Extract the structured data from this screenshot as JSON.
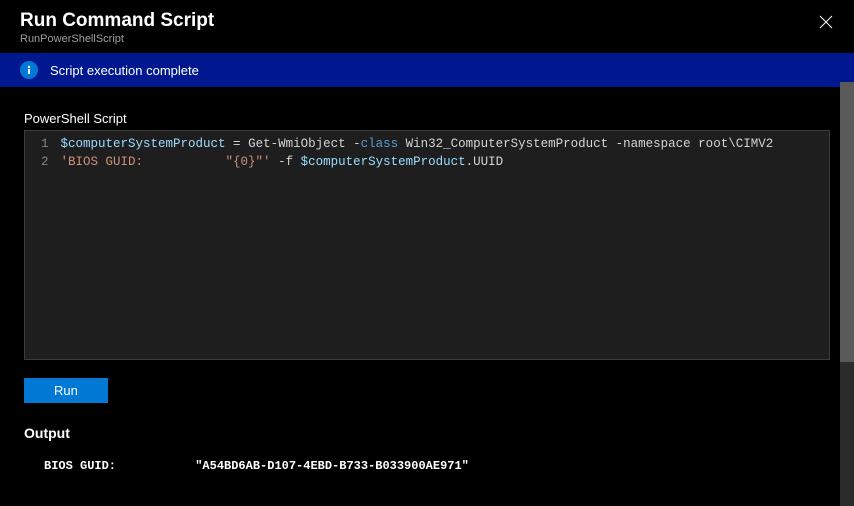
{
  "header": {
    "title": "Run Command Script",
    "subtitle": "RunPowerShellScript"
  },
  "status": {
    "message": "Script execution complete"
  },
  "editor": {
    "label": "PowerShell Script",
    "lines": {
      "num1": "1",
      "num2": "2"
    },
    "code": {
      "line1_var": "$computerSystemProduct",
      "line1_eq": " = ",
      "line1_cmdlet": "Get-WmiObject",
      "line1_param1": " -",
      "line1_keyword": "class",
      "line1_type": " Win32_ComputerSystemProduct ",
      "line1_param2": "-namespace root\\CIMV2",
      "line2_string": "'BIOS GUID:           \"{0}\"'",
      "line2_fmt": " -f ",
      "line2_var": "$computerSystemProduct",
      "line2_dot": ".",
      "line2_prop": "UUID"
    }
  },
  "run": {
    "label": "Run"
  },
  "output": {
    "label": "Output",
    "content": "BIOS GUID:           \"A54BD6AB-D107-4EBD-B733-B033900AE971\""
  }
}
